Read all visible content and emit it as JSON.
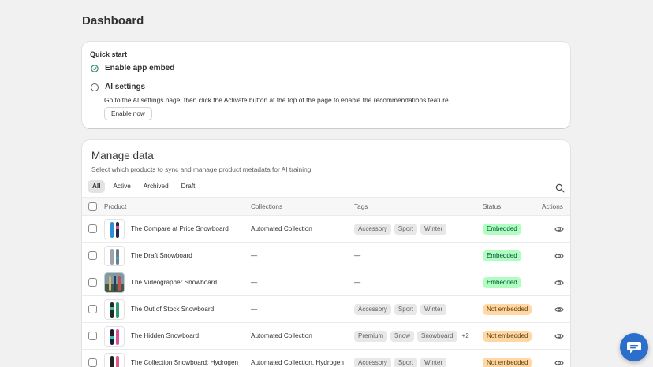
{
  "page": {
    "title": "Dashboard"
  },
  "quick_start": {
    "title": "Quick start",
    "steps": [
      {
        "label": "Enable app embed",
        "done": true
      },
      {
        "label": "AI settings",
        "done": false,
        "description": "Go to the AI settings page, then click the Activate button at the top of the page to enable the recommendations feature.",
        "button_label": "Enable now"
      }
    ]
  },
  "manage_data": {
    "title": "Manage data",
    "subtitle": "Select which products to sync and manage product metadata for AI training",
    "tabs": [
      {
        "label": "All",
        "active": true
      },
      {
        "label": "Active",
        "active": false
      },
      {
        "label": "Archived",
        "active": false
      },
      {
        "label": "Draft",
        "active": false
      }
    ],
    "columns": {
      "product": "Product",
      "collections": "Collections",
      "tags": "Tags",
      "status": "Status",
      "actions": "Actions"
    },
    "rows": [
      {
        "product": "The Compare at Price Snowboard",
        "collections": "Automated Collection",
        "tags": [
          "Accessory",
          "Sport",
          "Winter"
        ],
        "more": "",
        "status": "Embedded",
        "embedded": true,
        "icon": "snowboard-blue-icon"
      },
      {
        "product": "The Draft Snowboard",
        "collections": "—",
        "tags": [],
        "tags_empty": "—",
        "more": "",
        "status": "Embedded",
        "embedded": true,
        "icon": "snowboard-gray-icon"
      },
      {
        "product": "The Videographer Snowboard",
        "collections": "—",
        "tags": [],
        "tags_empty": "—",
        "more": "",
        "status": "Embedded",
        "embedded": true,
        "icon": "snowboard-photo-icon"
      },
      {
        "product": "The Out of Stock Snowboard",
        "collections": "—",
        "tags": [
          "Accessory",
          "Sport",
          "Winter"
        ],
        "more": "",
        "status": "Not embedded",
        "embedded": false,
        "icon": "snowboard-green-icon"
      },
      {
        "product": "The Hidden Snowboard",
        "collections": "Automated Collection",
        "tags": [
          "Premium",
          "Snow",
          "Snowboard"
        ],
        "more": "+2",
        "status": "Not embedded",
        "embedded": false,
        "icon": "snowboard-pink-icon"
      },
      {
        "product": "The Collection Snowboard: Hydrogen",
        "collections": "Automated Collection, Hydrogen",
        "tags": [
          "Accessory",
          "Sport",
          "Winter"
        ],
        "more": "",
        "status": "Not embedded",
        "embedded": false,
        "icon": "snowboard-dark-icon"
      }
    ]
  },
  "colors": {
    "embedded_bg": "#affebf",
    "not_embedded_bg": "#ffd6a4",
    "chat_button": "#2c6ecb"
  }
}
